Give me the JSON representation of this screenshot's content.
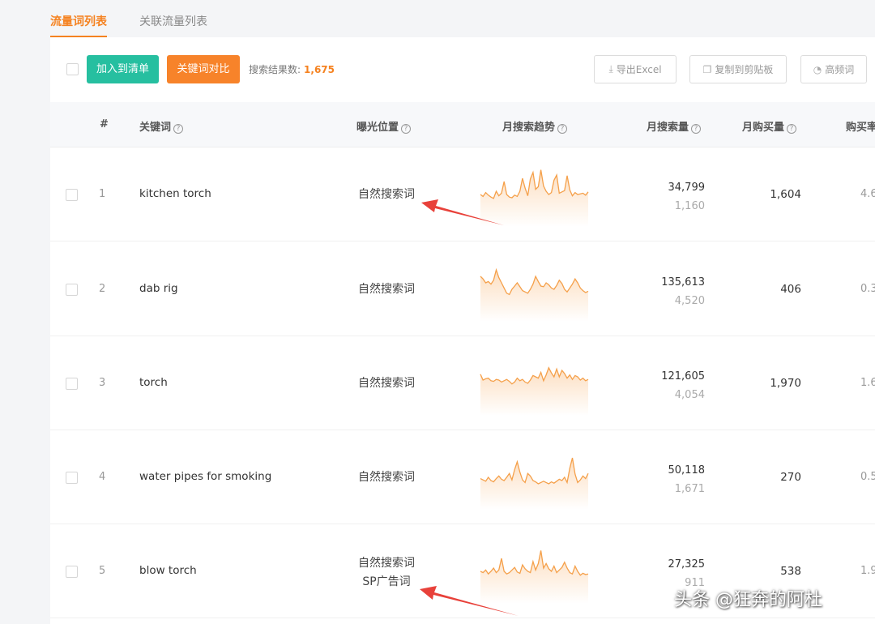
{
  "tabs": [
    {
      "label": "流量词列表",
      "active": true
    },
    {
      "label": "关联流量列表",
      "active": false
    }
  ],
  "toolbar": {
    "add_to_list": "加入到清单",
    "compare": "关键词对比",
    "result_label": "搜索结果数:",
    "result_count": "1,675",
    "export_excel": "导出Excel",
    "copy_clipboard": "复制到剪贴板",
    "high_freq": "高频词"
  },
  "columns": {
    "index": "#",
    "keyword": "关键词",
    "exposure": "曝光位置",
    "trend": "月搜索趋势",
    "monthly_search": "月搜索量",
    "monthly_purchase": "月购买量",
    "purchase_rate": "购买率"
  },
  "rows": [
    {
      "index": "1",
      "keyword": "kitchen torch",
      "positions": [
        "自然搜索词"
      ],
      "search": "34,799",
      "search_sub": "1,160",
      "purchase": "1,604",
      "rate": "4.6",
      "trend": [
        50,
        47,
        53,
        49,
        46,
        44,
        55,
        48,
        52,
        70,
        50,
        46,
        45,
        49,
        47,
        55,
        75,
        60,
        48,
        74,
        84,
        58,
        62,
        88,
        63,
        55,
        50,
        53,
        72,
        80,
        52,
        54,
        56,
        79,
        57,
        48,
        53,
        50,
        51,
        52,
        49,
        54
      ]
    },
    {
      "index": "2",
      "keyword": "dab rig",
      "positions": [
        "自然搜索词"
      ],
      "search": "135,613",
      "search_sub": "4,520",
      "purchase": "406",
      "rate": "0.3",
      "trend": [
        70,
        66,
        60,
        62,
        58,
        64,
        80,
        68,
        60,
        52,
        44,
        42,
        50,
        55,
        60,
        54,
        48,
        46,
        44,
        50,
        58,
        70,
        62,
        55,
        54,
        60,
        57,
        52,
        50,
        56,
        64,
        59,
        50,
        46,
        52,
        58,
        66,
        60,
        52,
        48,
        45,
        47
      ]
    },
    {
      "index": "3",
      "keyword": "torch",
      "positions": [
        "自然搜索词"
      ],
      "search": "121,605",
      "search_sub": "4,054",
      "purchase": "1,970",
      "rate": "1.6",
      "trend": [
        64,
        55,
        57,
        58,
        54,
        53,
        56,
        55,
        52,
        54,
        56,
        53,
        49,
        52,
        58,
        54,
        56,
        52,
        50,
        55,
        62,
        60,
        58,
        67,
        54,
        63,
        74,
        66,
        60,
        72,
        60,
        70,
        65,
        58,
        63,
        56,
        62,
        60,
        55,
        58,
        54,
        56
      ]
    },
    {
      "index": "4",
      "keyword": "water pipes for smoking",
      "positions": [
        "自然搜索词"
      ],
      "search": "50,118",
      "search_sub": "1,671",
      "purchase": "270",
      "rate": "0.5",
      "trend": [
        48,
        46,
        44,
        50,
        45,
        43,
        48,
        52,
        47,
        45,
        50,
        56,
        46,
        62,
        74,
        58,
        46,
        42,
        56,
        52,
        45,
        43,
        40,
        42,
        44,
        42,
        40,
        43,
        41,
        44,
        47,
        45,
        50,
        42,
        64,
        80,
        55,
        42,
        46,
        52,
        48,
        56
      ]
    },
    {
      "index": "5",
      "keyword": "blow torch",
      "positions": [
        "自然搜索词",
        "SP广告词"
      ],
      "search": "27,325",
      "search_sub": "911",
      "purchase": "538",
      "rate": "1.9",
      "trend": [
        50,
        48,
        52,
        46,
        50,
        55,
        48,
        52,
        70,
        50,
        46,
        48,
        52,
        56,
        49,
        47,
        60,
        54,
        50,
        48,
        65,
        52,
        62,
        82,
        55,
        62,
        54,
        50,
        58,
        48,
        52,
        56,
        64,
        55,
        48,
        46,
        58,
        50,
        44,
        47,
        45,
        46
      ]
    }
  ],
  "watermark": "头条 @狂奔的阿杜",
  "colors": {
    "accent": "#f58220",
    "green": "#26bfa0",
    "arrow": "#e8413a"
  }
}
